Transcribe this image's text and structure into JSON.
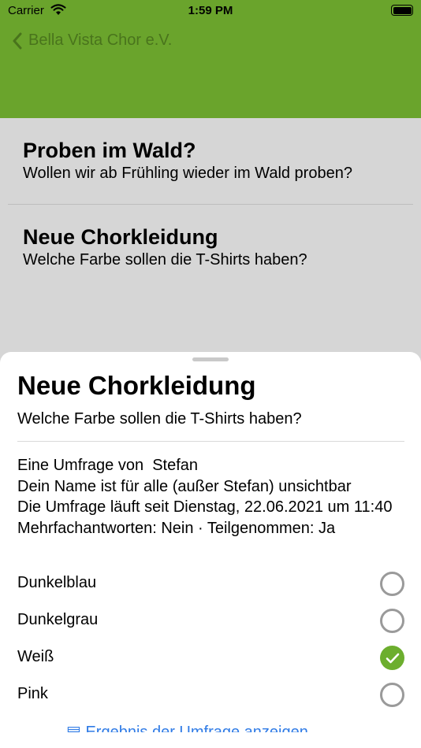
{
  "status_bar": {
    "carrier": "Carrier",
    "time": "1:59 PM"
  },
  "nav": {
    "back_label": "Bella Vista Chor e.V."
  },
  "colors": {
    "brand_green": "#6aa42c",
    "selected_green": "#6cae2e",
    "link_blue": "#2f7be6"
  },
  "list": [
    {
      "title": "Proben im Wald?",
      "subtitle": "Wollen wir ab Frühling wieder im Wald proben?"
    },
    {
      "title": "Neue Chorkleidung",
      "subtitle": "Welche Farbe sollen die T-Shirts haben?"
    }
  ],
  "sheet": {
    "title": "Neue Chorkleidung",
    "question": "Welche Farbe sollen die T-Shirts haben?",
    "meta": {
      "author": "Eine Umfrage von  Stefan",
      "anonymity": "Dein Name ist für alle (außer Stefan) unsichtbar",
      "running_since": "Die Umfrage läuft seit Dienstag, 22.06.2021 um 11:40",
      "details": "Mehrfachantworten: Nein · Teilgenommen: Ja"
    },
    "options": [
      {
        "label": "Dunkelblau",
        "selected": false
      },
      {
        "label": "Dunkelgrau",
        "selected": false
      },
      {
        "label": "Weiß",
        "selected": true
      },
      {
        "label": "Pink",
        "selected": false
      }
    ],
    "footer_link": "Ergebnis der Umfrage anzeigen",
    "icons": {
      "selected": "checkmark-icon",
      "footer": "chart-icon"
    }
  }
}
